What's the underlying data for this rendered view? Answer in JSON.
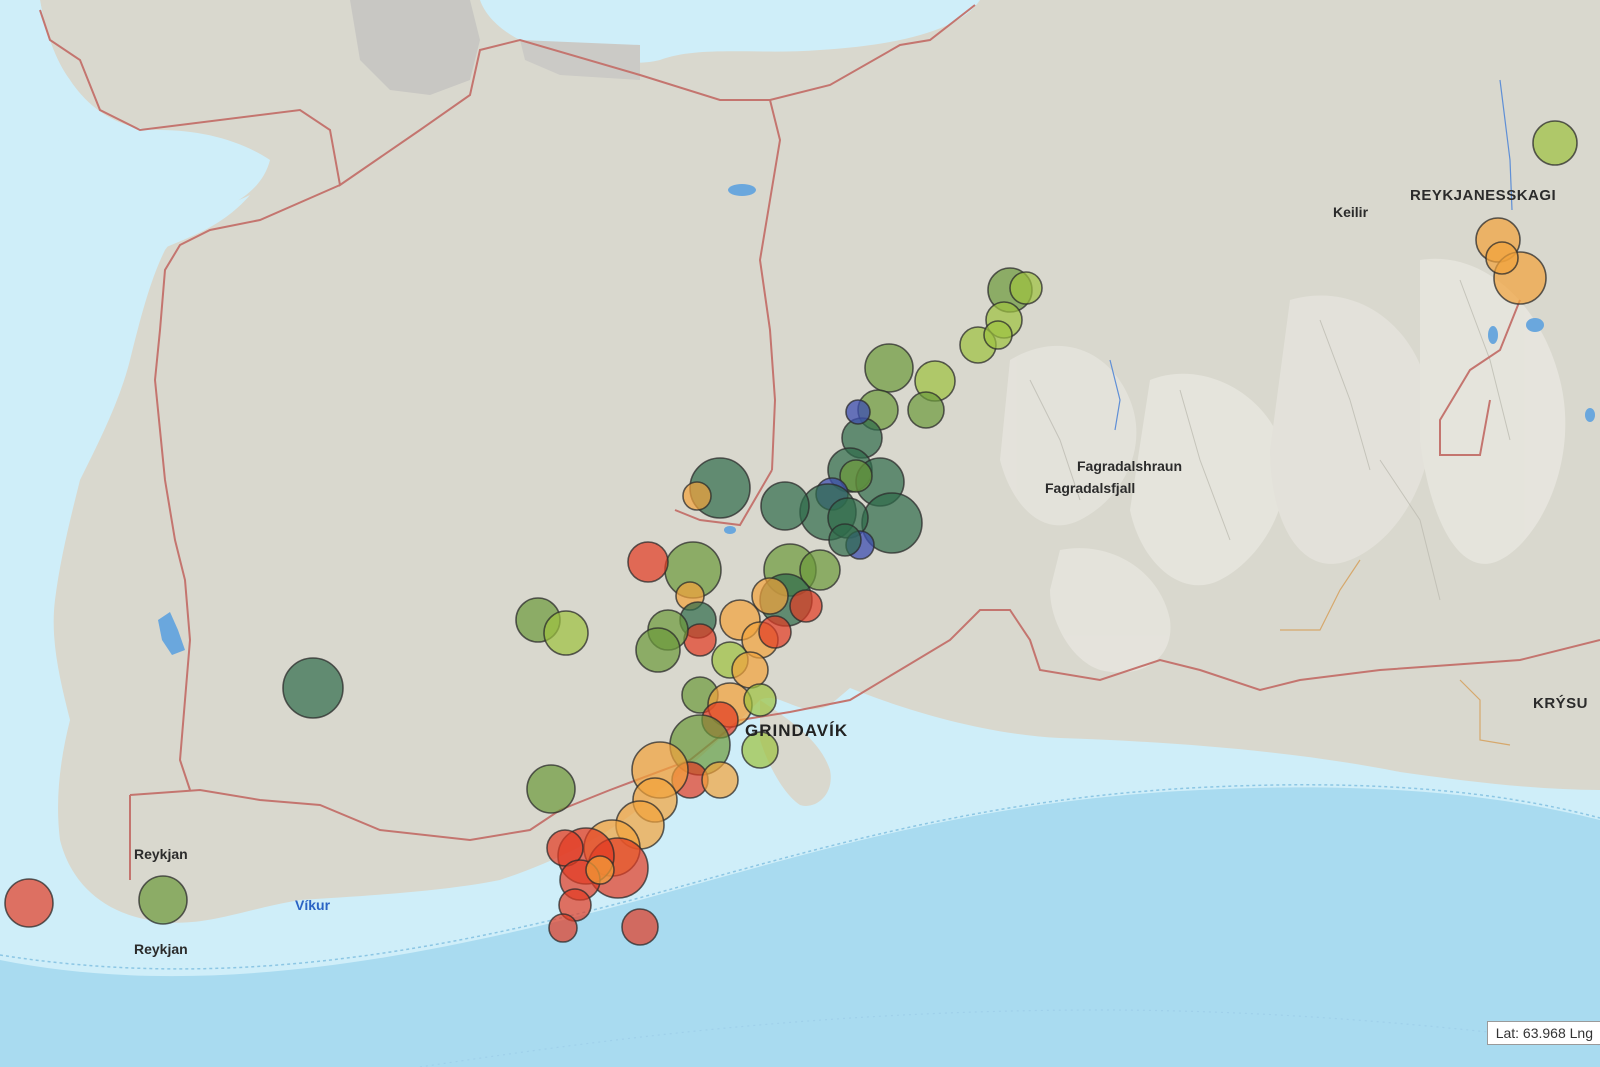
{
  "map": {
    "places": {
      "reykjanesskagi": "REYKJANESSKAGI",
      "keilir": "Keilir",
      "fagradalshraun": "Fagradalshraun",
      "fagradalsfjall": "Fagradalsfjall",
      "krysu": "KRÝSU",
      "grindavik": "GRINDAVÍK",
      "reykjan_upper": "Reykjan",
      "reykjan_lower": "Reykjan",
      "vikur": "Víkur"
    },
    "coordinate_readout": "Lat: 63.968 Lng"
  },
  "legend_colors": {
    "oldest": "#2e6b4a",
    "older": "#6b9a3a",
    "mid": "#9cc23e",
    "recent": "#f2a33a",
    "newest": "#e23a22",
    "deep": "#3d4fb0"
  },
  "earthquakes": {
    "count_shown": 118
  }
}
